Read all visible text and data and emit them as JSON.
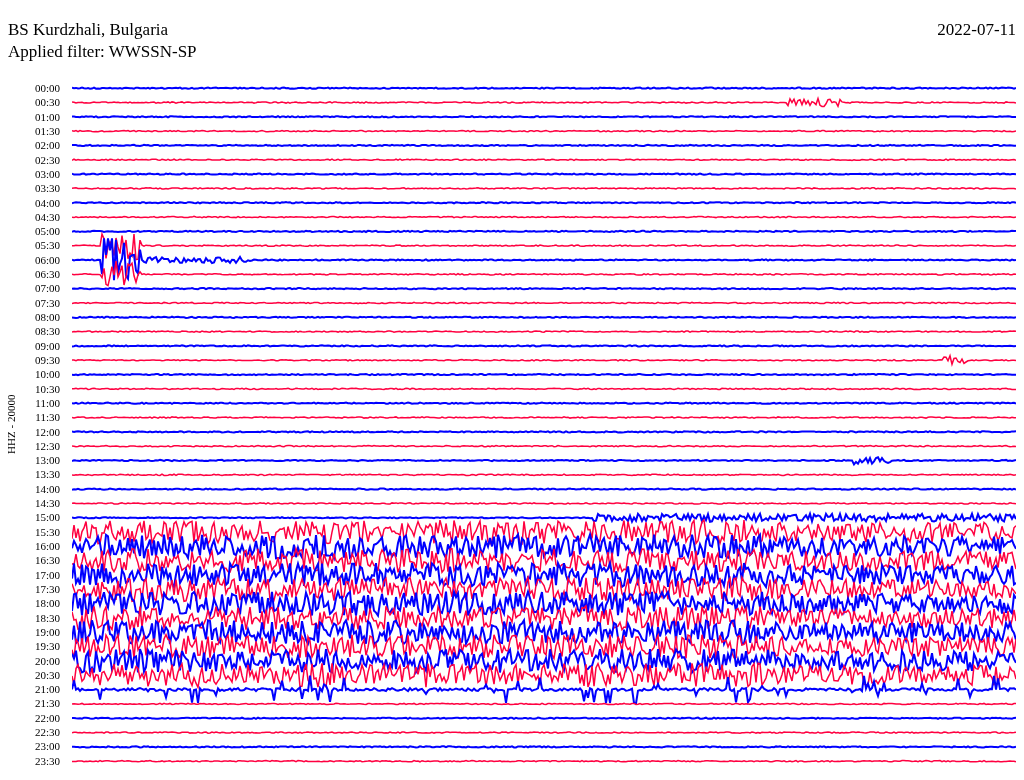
{
  "header": {
    "station": "BS Kurdzhali, Bulgaria",
    "date": "2022-07-11",
    "filter": "Applied filter: WWSSN-SP"
  },
  "plot": {
    "axis_label": "HHZ - 20000",
    "rows": [
      {
        "time": "00:00",
        "color": "#0000ff"
      },
      {
        "time": "00:30",
        "color": "#ff0040"
      },
      {
        "time": "01:00",
        "color": "#0000ff"
      },
      {
        "time": "01:30",
        "color": "#ff0040"
      },
      {
        "time": "02:00",
        "color": "#0000ff"
      },
      {
        "time": "02:30",
        "color": "#ff0040"
      },
      {
        "time": "03:00",
        "color": "#0000ff"
      },
      {
        "time": "03:30",
        "color": "#ff0040"
      },
      {
        "time": "04:00",
        "color": "#0000ff"
      },
      {
        "time": "04:30",
        "color": "#ff0040"
      },
      {
        "time": "05:00",
        "color": "#0000ff"
      },
      {
        "time": "05:30",
        "color": "#ff0040"
      },
      {
        "time": "06:00",
        "color": "#0000ff"
      },
      {
        "time": "06:30",
        "color": "#ff0040"
      },
      {
        "time": "07:00",
        "color": "#0000ff"
      },
      {
        "time": "07:30",
        "color": "#ff0040"
      },
      {
        "time": "08:00",
        "color": "#0000ff"
      },
      {
        "time": "08:30",
        "color": "#ff0040"
      },
      {
        "time": "09:00",
        "color": "#0000ff"
      },
      {
        "time": "09:30",
        "color": "#ff0040"
      },
      {
        "time": "10:00",
        "color": "#0000ff"
      },
      {
        "time": "10:30",
        "color": "#ff0040"
      },
      {
        "time": "11:00",
        "color": "#0000ff"
      },
      {
        "time": "11:30",
        "color": "#ff0040"
      },
      {
        "time": "12:00",
        "color": "#0000ff"
      },
      {
        "time": "12:30",
        "color": "#ff0040"
      },
      {
        "time": "13:00",
        "color": "#0000ff"
      },
      {
        "time": "13:30",
        "color": "#ff0040"
      },
      {
        "time": "14:00",
        "color": "#0000ff"
      },
      {
        "time": "14:30",
        "color": "#ff0040"
      },
      {
        "time": "15:00",
        "color": "#0000ff"
      },
      {
        "time": "15:30",
        "color": "#ff0040"
      },
      {
        "time": "16:00",
        "color": "#0000ff"
      },
      {
        "time": "16:30",
        "color": "#ff0040"
      },
      {
        "time": "17:00",
        "color": "#0000ff"
      },
      {
        "time": "17:30",
        "color": "#ff0040"
      },
      {
        "time": "18:00",
        "color": "#0000ff"
      },
      {
        "time": "18:30",
        "color": "#ff0040"
      },
      {
        "time": "19:00",
        "color": "#0000ff"
      },
      {
        "time": "19:30",
        "color": "#ff0040"
      },
      {
        "time": "20:00",
        "color": "#0000ff"
      },
      {
        "time": "20:30",
        "color": "#ff0040"
      },
      {
        "time": "21:00",
        "color": "#0000ff"
      },
      {
        "time": "21:30",
        "color": "#ff0040"
      },
      {
        "time": "22:00",
        "color": "#0000ff"
      },
      {
        "time": "22:30",
        "color": "#ff0040"
      },
      {
        "time": "23:00",
        "color": "#0000ff"
      },
      {
        "time": "23:30",
        "color": "#ff0040"
      }
    ]
  }
}
